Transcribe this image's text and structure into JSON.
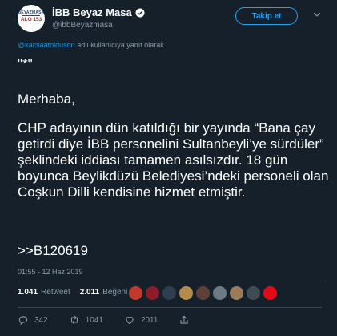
{
  "header": {
    "name": "İBB Beyaz Masa",
    "handle": "@ibbBeyazmasa",
    "follow_label": "Takip et",
    "avatar_text_top": "BEYAZMASA",
    "avatar_text_bottom": "ALO 153"
  },
  "reply": {
    "mention": "@kacsaatolduson",
    "suffix": " adlı kullanıcıya yanıt olarak"
  },
  "tweet": {
    "line1": "\"*\"",
    "line2": "Merhaba,",
    "line3": "CHP adayının dün katıldığı bir yayında “Bana çay getirdi diye İBB personelini Sultanbeyli’ye sürdüler” şeklindeki iddiası tamamen asılsızdır. 18 gün boyunca Beylikdüzü Belediyesi’ndeki personeli olan Coşkun Dilli kendisine hizmet etmiştir.",
    "line4": ">>B120619"
  },
  "timestamp": "01:55 - 12 Haz 2019",
  "stats": {
    "retweets": "1.041",
    "retweets_label": "Retweet",
    "likes": "2.011",
    "likes_label": "Beğeni"
  },
  "actions": {
    "replies": "342",
    "retweets": "1041",
    "likes": "2011"
  },
  "colors": {
    "background": "#15202b",
    "accent": "#1da1f2",
    "muted": "#8899a6",
    "divider": "#38444d"
  }
}
